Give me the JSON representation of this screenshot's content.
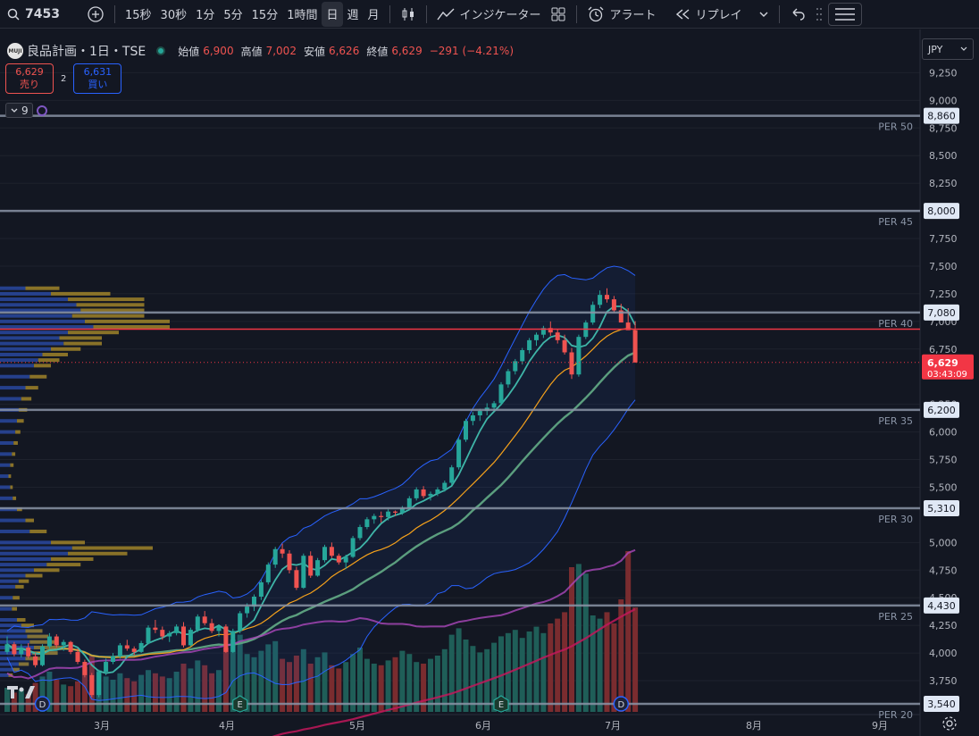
{
  "toolbar": {
    "symbol": "7453",
    "intervals": [
      "15秒",
      "30秒",
      "1分",
      "5分",
      "15分",
      "1時間",
      "日",
      "週",
      "月"
    ],
    "active_interval": "日",
    "indicators_label": "インジケーター",
    "alert_label": "アラート",
    "replay_label": "リプレイ"
  },
  "legend": {
    "name": "良品計画・1日・TSE",
    "logo_text": "MUJI",
    "open_label": "始値",
    "open": "6,900",
    "high_label": "高値",
    "high": "7,002",
    "low_label": "安値",
    "low": "6,626",
    "close_label": "終値",
    "close": "6,629",
    "change": "−291 (−4.21%)"
  },
  "trade": {
    "sell_price": "6,629",
    "sell_label": "売り",
    "spread": "2",
    "buy_price": "6,631",
    "buy_label": "買い"
  },
  "indicator_count": "9",
  "currency": "JPY",
  "colors": {
    "up": "#26a69a",
    "down": "#ef5350",
    "background": "#131722",
    "grid": "#1e222d",
    "hline": "#8a94a6",
    "last_price": "#f23645",
    "ma_short": "#26a69a",
    "ma_mid": "#f7a21b",
    "ma_long": "#5b9e7e",
    "ma_200": "#c2185b",
    "bb": "#2962ff",
    "vol_ma": "#ab47bc",
    "vp_blue": "#2b4ba8",
    "vp_gold": "#a88a2a"
  },
  "chart_data": {
    "type": "candlestick",
    "y_ticks": [
      9250,
      9000,
      8750,
      8500,
      8250,
      7750,
      7500,
      7250,
      7000,
      6750,
      6250,
      6000,
      5750,
      5500,
      5000,
      4750,
      4500,
      4250,
      4000,
      3750
    ],
    "y_range": [
      3500,
      9350
    ],
    "x_labels": [
      "3月",
      "4月",
      "5月",
      "6月",
      "7月",
      "8月",
      "9月"
    ],
    "horizontal_levels": [
      {
        "label": "PER 50",
        "value": 8860
      },
      {
        "label": "PER 45",
        "value": 8000
      },
      {
        "label": "PER 40",
        "value": 7080
      },
      {
        "label": "PER 35",
        "value": 6200
      },
      {
        "label": "PER 30",
        "value": 5310
      },
      {
        "label": "PER 25",
        "value": 4430
      },
      {
        "label": "PER 20",
        "value": 3540
      }
    ],
    "last_price": 6629,
    "last_price_label": "6,629",
    "countdown": "03:43:09",
    "red_level": 6930,
    "event_markers": [
      {
        "type": "dividend",
        "label": "D",
        "date_index": 5
      },
      {
        "type": "earnings",
        "label": "E",
        "date_index": 33
      },
      {
        "type": "earnings",
        "label": "E",
        "date_index": 70
      },
      {
        "type": "dividend",
        "label": "D",
        "date_index": 87
      }
    ],
    "candles": [
      [
        4010,
        4150,
        3990,
        4080
      ],
      [
        4080,
        4100,
        3970,
        3990
      ],
      [
        3990,
        4080,
        3960,
        4050
      ],
      [
        4050,
        4090,
        3950,
        3970
      ],
      [
        3970,
        4000,
        3870,
        3890
      ],
      [
        3890,
        4080,
        3880,
        4060
      ],
      [
        4060,
        4180,
        4040,
        4150
      ],
      [
        4150,
        4170,
        4050,
        4070
      ],
      [
        4070,
        4120,
        4020,
        4100
      ],
      [
        4100,
        4110,
        3990,
        4010
      ],
      [
        4010,
        4040,
        3900,
        3920
      ],
      [
        3920,
        3940,
        3780,
        3800
      ],
      [
        3800,
        3820,
        3600,
        3620
      ],
      [
        3620,
        3850,
        3600,
        3830
      ],
      [
        3830,
        3950,
        3800,
        3920
      ],
      [
        3920,
        4000,
        3900,
        3970
      ],
      [
        3970,
        4090,
        3950,
        4070
      ],
      [
        4070,
        4120,
        4020,
        4040
      ],
      [
        4040,
        4060,
        3980,
        4010
      ],
      [
        4010,
        4110,
        4000,
        4090
      ],
      [
        4090,
        4250,
        4080,
        4230
      ],
      [
        4230,
        4300,
        4180,
        4210
      ],
      [
        4210,
        4240,
        4120,
        4150
      ],
      [
        4150,
        4200,
        4100,
        4180
      ],
      [
        4180,
        4260,
        4160,
        4240
      ],
      [
        4240,
        4280,
        4050,
        4070
      ],
      [
        4070,
        4230,
        4060,
        4210
      ],
      [
        4210,
        4350,
        4190,
        4330
      ],
      [
        4330,
        4380,
        4250,
        4270
      ],
      [
        4270,
        4310,
        4180,
        4200
      ],
      [
        4200,
        4260,
        4150,
        4240
      ],
      [
        4240,
        4260,
        4000,
        4010
      ],
      [
        4010,
        4220,
        4000,
        4200
      ],
      [
        4200,
        4380,
        4180,
        4360
      ],
      [
        4360,
        4450,
        4320,
        4420
      ],
      [
        4420,
        4530,
        4380,
        4510
      ],
      [
        4510,
        4660,
        4480,
        4640
      ],
      [
        4640,
        4820,
        4620,
        4800
      ],
      [
        4800,
        4960,
        4770,
        4940
      ],
      [
        4940,
        4990,
        4860,
        4900
      ],
      [
        4900,
        4930,
        4720,
        4750
      ],
      [
        4750,
        4780,
        4570,
        4590
      ],
      [
        4590,
        4900,
        4580,
        4880
      ],
      [
        4880,
        4920,
        4680,
        4700
      ],
      [
        4700,
        4860,
        4690,
        4840
      ],
      [
        4840,
        4980,
        4820,
        4960
      ],
      [
        4960,
        5000,
        4860,
        4880
      ],
      [
        4880,
        4900,
        4800,
        4820
      ],
      [
        4820,
        4890,
        4760,
        4870
      ],
      [
        4870,
        5060,
        4860,
        5040
      ],
      [
        5040,
        5160,
        5020,
        5140
      ],
      [
        5140,
        5230,
        5120,
        5210
      ],
      [
        5210,
        5260,
        5170,
        5240
      ],
      [
        5240,
        5280,
        5180,
        5230
      ],
      [
        5230,
        5300,
        5200,
        5280
      ],
      [
        5280,
        5290,
        5240,
        5270
      ],
      [
        5270,
        5330,
        5250,
        5310
      ],
      [
        5310,
        5420,
        5290,
        5400
      ],
      [
        5400,
        5500,
        5380,
        5480
      ],
      [
        5480,
        5510,
        5400,
        5420
      ],
      [
        5420,
        5460,
        5380,
        5440
      ],
      [
        5440,
        5500,
        5420,
        5480
      ],
      [
        5480,
        5560,
        5460,
        5540
      ],
      [
        5540,
        5700,
        5520,
        5680
      ],
      [
        5680,
        5950,
        5660,
        5930
      ],
      [
        5930,
        6120,
        5910,
        6100
      ],
      [
        6100,
        6180,
        6060,
        6150
      ],
      [
        6150,
        6210,
        6100,
        6190
      ],
      [
        6190,
        6260,
        6150,
        6220
      ],
      [
        6220,
        6280,
        6190,
        6260
      ],
      [
        6260,
        6450,
        6240,
        6430
      ],
      [
        6430,
        6570,
        6400,
        6550
      ],
      [
        6550,
        6660,
        6520,
        6640
      ],
      [
        6640,
        6760,
        6610,
        6740
      ],
      [
        6740,
        6850,
        6710,
        6830
      ],
      [
        6830,
        6900,
        6780,
        6880
      ],
      [
        6880,
        6960,
        6850,
        6940
      ],
      [
        6940,
        7000,
        6870,
        6900
      ],
      [
        6900,
        6930,
        6800,
        6830
      ],
      [
        6830,
        6880,
        6700,
        6720
      ],
      [
        6720,
        6760,
        6480,
        6520
      ],
      [
        6520,
        6880,
        6500,
        6860
      ],
      [
        6860,
        7010,
        6840,
        6990
      ],
      [
        6990,
        7180,
        6970,
        7150
      ],
      [
        7150,
        7280,
        7120,
        7240
      ],
      [
        7240,
        7300,
        7170,
        7200
      ],
      [
        7200,
        7230,
        7080,
        7100
      ],
      [
        7100,
        7160,
        7030,
        6990
      ],
      [
        6990,
        7120,
        6950,
        6920
      ],
      [
        6920,
        7002,
        6626,
        6629
      ]
    ],
    "volumes": [
      15,
      12,
      14,
      11,
      18,
      22,
      25,
      20,
      17,
      16,
      19,
      28,
      35,
      26,
      22,
      20,
      24,
      21,
      19,
      23,
      26,
      24,
      22,
      21,
      25,
      30,
      27,
      32,
      29,
      24,
      26,
      40,
      45,
      48,
      36,
      34,
      38,
      42,
      44,
      33,
      31,
      35,
      39,
      30,
      34,
      37,
      29,
      27,
      31,
      36,
      40,
      33,
      30,
      29,
      32,
      34,
      38,
      36,
      31,
      30,
      33,
      35,
      39,
      48,
      52,
      45,
      41,
      37,
      39,
      43,
      47,
      49,
      51,
      46,
      50,
      53,
      49,
      55,
      58,
      62,
      90,
      92,
      86,
      60,
      58,
      62,
      55,
      70,
      100,
      65
    ],
    "volume_profile": [
      {
        "price": 7300,
        "blue": 30,
        "gold": 40
      },
      {
        "price": 7250,
        "blue": 60,
        "gold": 70
      },
      {
        "price": 7200,
        "blue": 80,
        "gold": 90
      },
      {
        "price": 7150,
        "blue": 90,
        "gold": 80
      },
      {
        "price": 7100,
        "blue": 95,
        "gold": 75
      },
      {
        "price": 7050,
        "blue": 85,
        "gold": 85
      },
      {
        "price": 7000,
        "blue": 100,
        "gold": 100
      },
      {
        "price": 6950,
        "blue": 110,
        "gold": 90
      },
      {
        "price": 6900,
        "blue": 80,
        "gold": 60
      },
      {
        "price": 6850,
        "blue": 70,
        "gold": 50
      },
      {
        "price": 6800,
        "blue": 75,
        "gold": 45
      },
      {
        "price": 6750,
        "blue": 60,
        "gold": 35
      },
      {
        "price": 6700,
        "blue": 50,
        "gold": 30
      },
      {
        "price": 6650,
        "blue": 45,
        "gold": 25
      },
      {
        "price": 6600,
        "blue": 40,
        "gold": 20
      },
      {
        "price": 6500,
        "blue": 35,
        "gold": 20
      },
      {
        "price": 6400,
        "blue": 30,
        "gold": 15
      },
      {
        "price": 6300,
        "blue": 25,
        "gold": 12
      },
      {
        "price": 6200,
        "blue": 22,
        "gold": 10
      },
      {
        "price": 6100,
        "blue": 20,
        "gold": 8
      },
      {
        "price": 6000,
        "blue": 18,
        "gold": 6
      },
      {
        "price": 5900,
        "blue": 16,
        "gold": 5
      },
      {
        "price": 5800,
        "blue": 14,
        "gold": 4
      },
      {
        "price": 5700,
        "blue": 12,
        "gold": 4
      },
      {
        "price": 5600,
        "blue": 10,
        "gold": 3
      },
      {
        "price": 5500,
        "blue": 12,
        "gold": 3
      },
      {
        "price": 5400,
        "blue": 15,
        "gold": 4
      },
      {
        "price": 5300,
        "blue": 20,
        "gold": 6
      },
      {
        "price": 5200,
        "blue": 30,
        "gold": 10
      },
      {
        "price": 5100,
        "blue": 35,
        "gold": 20
      },
      {
        "price": 5000,
        "blue": 60,
        "gold": 40
      },
      {
        "price": 4950,
        "blue": 85,
        "gold": 95
      },
      {
        "price": 4900,
        "blue": 80,
        "gold": 70
      },
      {
        "price": 4850,
        "blue": 60,
        "gold": 50
      },
      {
        "price": 4800,
        "blue": 55,
        "gold": 40
      },
      {
        "price": 4750,
        "blue": 40,
        "gold": 30
      },
      {
        "price": 4700,
        "blue": 30,
        "gold": 20
      },
      {
        "price": 4650,
        "blue": 22,
        "gold": 12
      },
      {
        "price": 4600,
        "blue": 18,
        "gold": 10
      },
      {
        "price": 4500,
        "blue": 15,
        "gold": 8
      },
      {
        "price": 4400,
        "blue": 14,
        "gold": 6
      },
      {
        "price": 4300,
        "blue": 20,
        "gold": 10
      },
      {
        "price": 4250,
        "blue": 25,
        "gold": 15
      },
      {
        "price": 4200,
        "blue": 30,
        "gold": 20
      },
      {
        "price": 4150,
        "blue": 32,
        "gold": 25
      },
      {
        "price": 4100,
        "blue": 35,
        "gold": 30
      },
      {
        "price": 4050,
        "blue": 40,
        "gold": 35
      },
      {
        "price": 4000,
        "blue": 38,
        "gold": 30
      },
      {
        "price": 3950,
        "blue": 30,
        "gold": 20
      },
      {
        "price": 3900,
        "blue": 22,
        "gold": 12
      },
      {
        "price": 3850,
        "blue": 15,
        "gold": 8
      },
      {
        "price": 3800,
        "blue": 10,
        "gold": 5
      }
    ]
  }
}
